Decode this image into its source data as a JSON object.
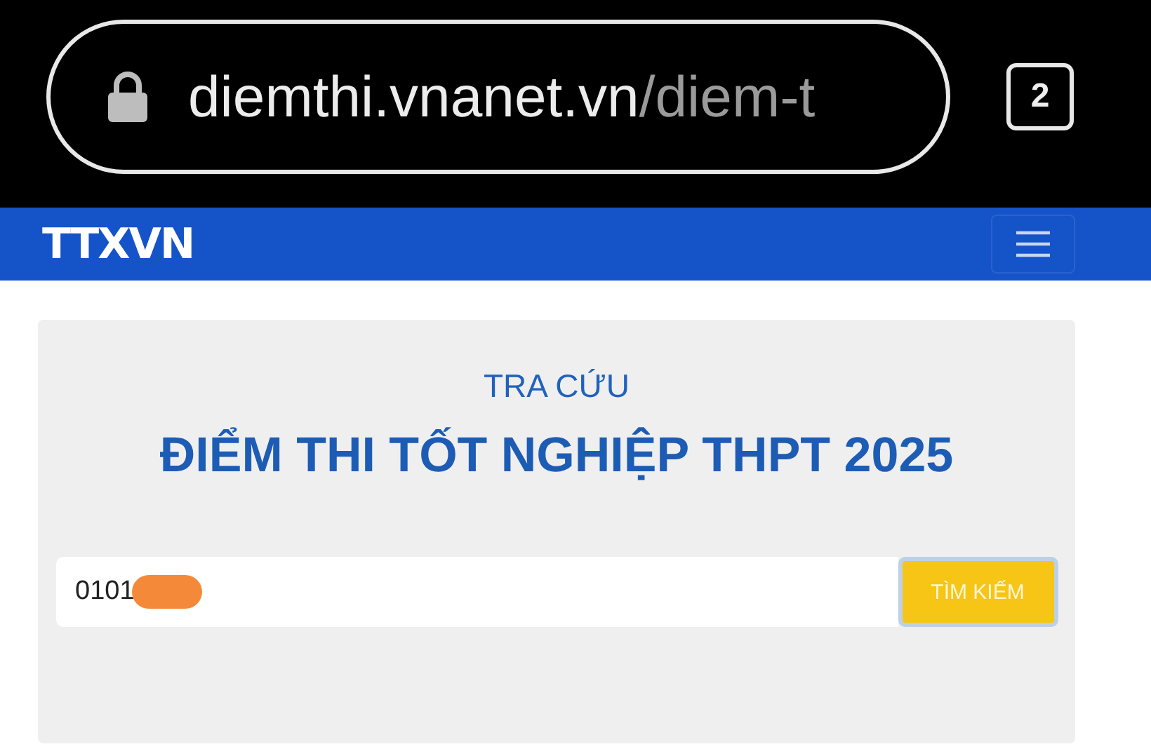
{
  "browser": {
    "url_host": "diemthi.vnanet.vn",
    "url_path": "/diem-t",
    "secure": true,
    "tab_count": "2"
  },
  "header": {
    "logo": "TTXVN"
  },
  "search_card": {
    "kicker": "TRA CỨU",
    "title": "ĐIỂM THI TỐT NGHIỆP THPT 2025",
    "field": {
      "value": "0101",
      "redacted": true
    },
    "button": "TÌM KIẾM"
  }
}
